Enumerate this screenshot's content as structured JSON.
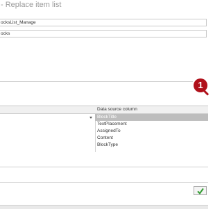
{
  "dialog": {
    "title": "- Replace item list"
  },
  "fields": {
    "list_name_value": "ocksList_Manage",
    "source_value": "ocks"
  },
  "annotation": {
    "marker_number": "1",
    "marker_color": "#b0101a"
  },
  "mapping": {
    "data_source_column_header": "Data source column",
    "columns": [
      "BlockTitle",
      "TextPlacement",
      "AssignedTo",
      "Content",
      "BlockType"
    ],
    "selected_index": 0
  },
  "footer": {
    "ok_icon": "green-checkmark-icon"
  }
}
